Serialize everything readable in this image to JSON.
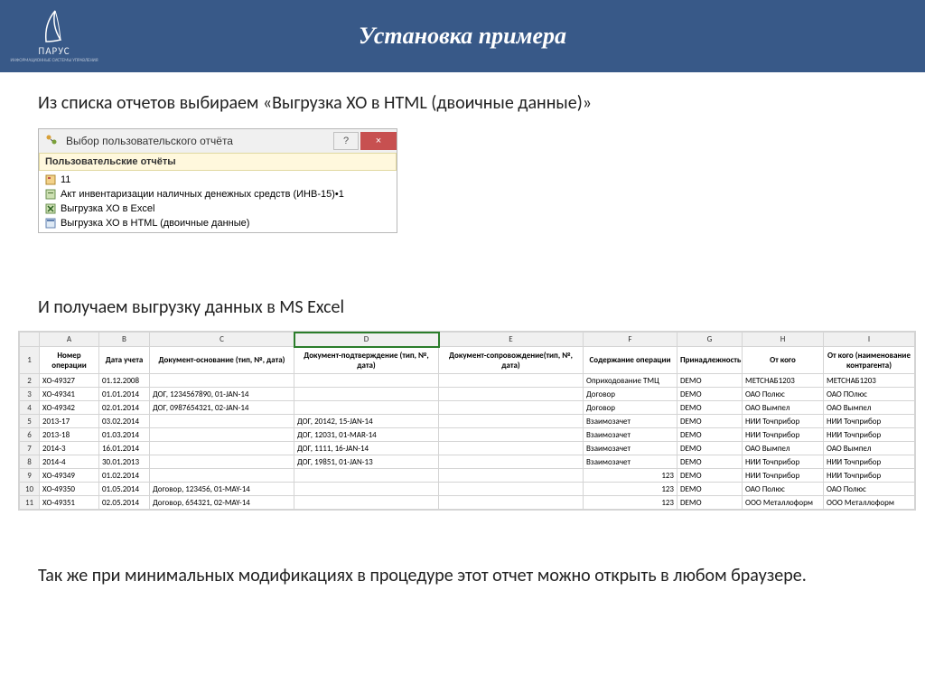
{
  "header": {
    "logo_text": "ПАРУС",
    "logo_sub": "ИНФОРМАЦИОННЫЕ СИСТЕМЫ УПРАВЛЕНИЯ",
    "title": "Установка примера"
  },
  "text": {
    "p1": "Из списка отчетов выбираем «Выгрузка ХО в HTML (двоичные данные)»",
    "p2": "И получаем выгрузку данных в MS Excel",
    "p3": "Так же при минимальных модификациях в процедуре этот отчет можно открыть в любом браузере."
  },
  "dialog": {
    "title": "Выбор пользовательского отчёта",
    "help": "?",
    "close": "×",
    "section": "Пользовательские отчёты",
    "items": [
      "11",
      "Акт инвентаризации наличных денежных средств (ИНВ-15)•1",
      "Выгрузка ХО в Excel",
      "Выгрузка ХО в HTML (двоичные данные)"
    ]
  },
  "excel": {
    "cols": [
      "A",
      "B",
      "C",
      "D",
      "E",
      "F",
      "G",
      "H",
      "I"
    ],
    "headers": [
      "Номер операции",
      "Дата учета",
      "Документ-основание (тип, №, дата)",
      "Документ-подтверждение (тип, №, дата)",
      "Документ-сопровождение(тип, №, дата)",
      "Содержание операции",
      "Принадлежность",
      "От кого",
      "От кого (наименование контрагента)"
    ],
    "rows": [
      {
        "n": "2",
        "c": [
          "ХО-49327",
          "01.12.2008",
          "",
          "",
          "",
          "Оприходование ТМЦ",
          "DEMO",
          "МЕТСНАБ1203",
          "МЕТСНАБ1203"
        ]
      },
      {
        "n": "3",
        "c": [
          "ХО-49341",
          "01.01.2014",
          "ДОГ, 1234567890, 01-JAN-14",
          "",
          "",
          "Договор",
          "DEMO",
          "ОАО Полюс",
          "ОАО ПОлюс"
        ]
      },
      {
        "n": "4",
        "c": [
          "ХО-49342",
          "02.01.2014",
          "ДОГ, 0987654321, 02-JAN-14",
          "",
          "",
          "Договор",
          "DEMO",
          "ОАО Вымпел",
          "ОАО Вымпел"
        ]
      },
      {
        "n": "5",
        "c": [
          "2013-17",
          "03.02.2014",
          "",
          "ДОГ, 20142, 15-JAN-14",
          "",
          "Взаимозачет",
          "DEMO",
          "НИИ Точприбор",
          "НИИ Точприбор"
        ]
      },
      {
        "n": "6",
        "c": [
          "2013-18",
          "01.03.2014",
          "",
          "ДОГ, 12031, 01-MAR-14",
          "",
          "Взаимозачет",
          "DEMO",
          "НИИ Точприбор",
          "НИИ Точприбор"
        ]
      },
      {
        "n": "7",
        "c": [
          "2014-3",
          "16.01.2014",
          "",
          "ДОГ, 1111, 16-JAN-14",
          "",
          "Взаимозачет",
          "DEMO",
          "ОАО Вымпел",
          "ОАО Вымпел"
        ]
      },
      {
        "n": "8",
        "c": [
          "2014-4",
          "30.01.2013",
          "",
          "ДОГ, 19851, 01-JAN-13",
          "",
          "Взаимозачет",
          "DEMO",
          "НИИ Точприбор",
          "НИИ Точприбор"
        ]
      },
      {
        "n": "9",
        "c": [
          "ХО-49349",
          "01.02.2014",
          "",
          "",
          "",
          "123",
          "DEMO",
          "НИИ Точприбор",
          "НИИ Точприбор"
        ]
      },
      {
        "n": "10",
        "c": [
          "ХО-49350",
          "01.05.2014",
          "Договор, 123456, 01-MAY-14",
          "",
          "",
          "123",
          "DEMO",
          "ОАО Полюс",
          "ОАО Полюс"
        ]
      },
      {
        "n": "11",
        "c": [
          "ХО-49351",
          "02.05.2014",
          "Договор, 654321, 02-MAY-14",
          "",
          "",
          "123",
          "DEMO",
          "ООО Металлоформ",
          "ООО Металлоформ"
        ]
      }
    ]
  }
}
